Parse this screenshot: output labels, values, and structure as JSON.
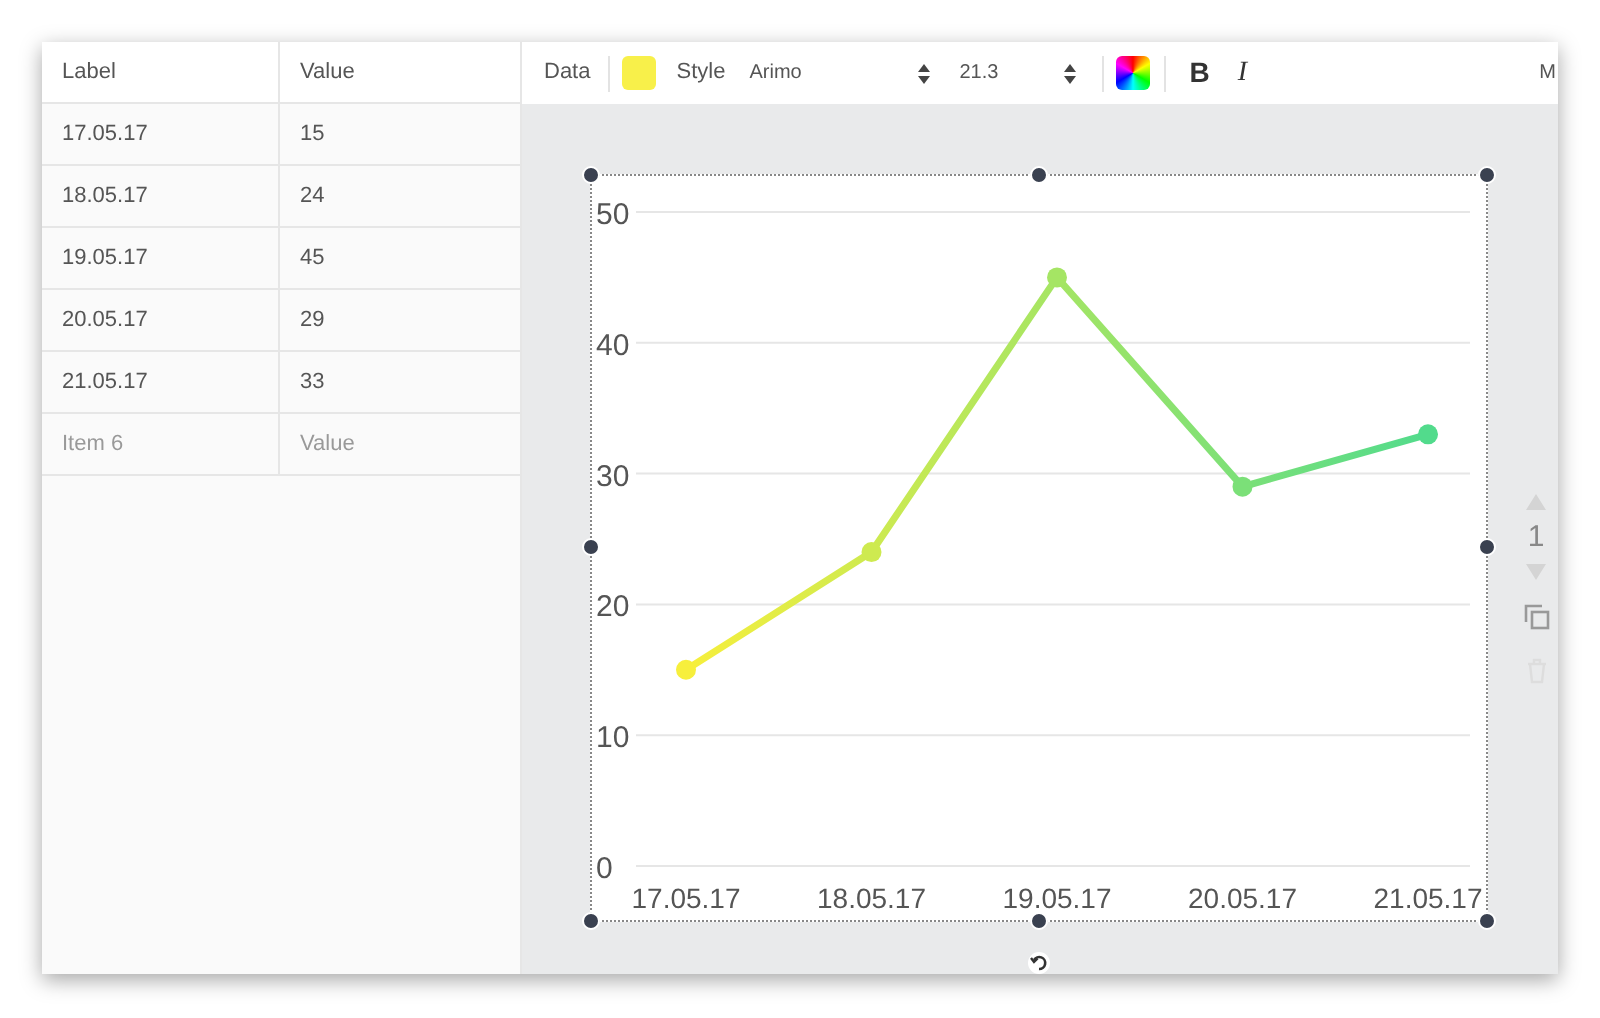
{
  "table": {
    "columns": [
      "Label",
      "Value"
    ],
    "rows": [
      {
        "label": "17.05.17",
        "value": "15",
        "placeholder": false
      },
      {
        "label": "18.05.17",
        "value": "24",
        "placeholder": false
      },
      {
        "label": "19.05.17",
        "value": "45",
        "placeholder": false
      },
      {
        "label": "20.05.17",
        "value": "29",
        "placeholder": false
      },
      {
        "label": "21.05.17",
        "value": "33",
        "placeholder": false
      },
      {
        "label": "Item 6",
        "value": "Value",
        "placeholder": true
      }
    ]
  },
  "toolbar": {
    "data_label": "Data",
    "swatch": {
      "color": "#f8f04a"
    },
    "style_label": "Style",
    "font": "Arimo",
    "font_size": "21.3",
    "bold": "B",
    "italic": "I",
    "cut_item": "M"
  },
  "layer": {
    "order": "1"
  },
  "chart": {
    "chart_data": {
      "type": "line",
      "categories": [
        "17.05.17",
        "18.05.17",
        "19.05.17",
        "20.05.17",
        "21.05.17"
      ],
      "series": [
        {
          "color": "#f7ef3c",
          "marker": "circle",
          "values": [
            15,
            24,
            45,
            29,
            33
          ]
        }
      ],
      "grid": true,
      "ylim": [
        0,
        50
      ],
      "yticks": [
        0,
        10,
        20,
        30,
        40,
        50
      ]
    },
    "gradient_end": {
      "color": "#52db8c"
    }
  }
}
